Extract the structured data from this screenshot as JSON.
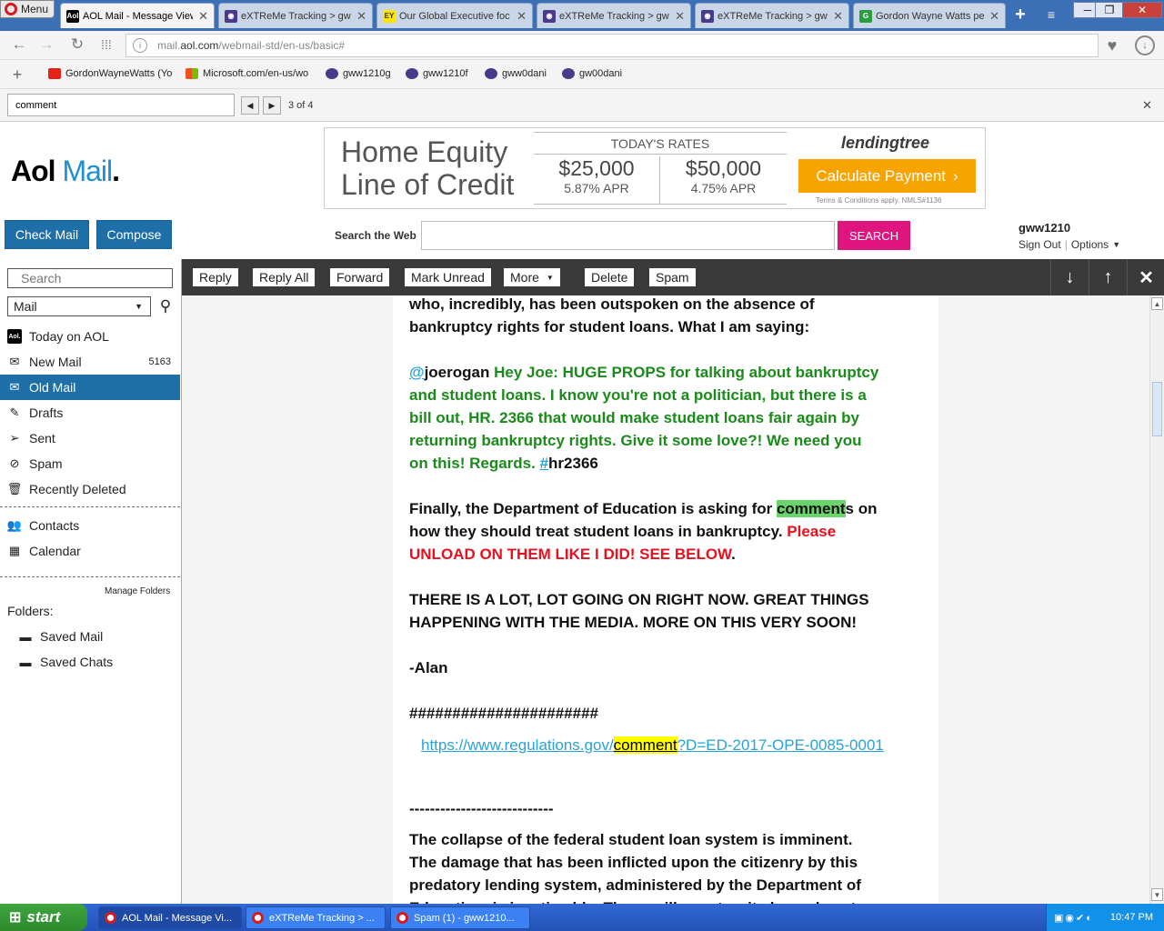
{
  "browser": {
    "menu_label": "Menu",
    "tabs": [
      {
        "icon": "aol-icon",
        "label": "AOL Mail - Message View",
        "active": true
      },
      {
        "icon": "extreme-icon",
        "label": "eXTReMe Tracking > gww"
      },
      {
        "icon": "ey-icon",
        "label": "Our Global Executive foc"
      },
      {
        "icon": "extreme-icon",
        "label": "eXTReMe Tracking > gww"
      },
      {
        "icon": "extreme-icon",
        "label": "eXTReMe Tracking > gww"
      },
      {
        "icon": "google-icon",
        "label": "Gordon Wayne Watts pe"
      }
    ],
    "url_prefix": "mail.",
    "url_domain": "aol.com",
    "url_path": "/webmail-std/en-us/basic#",
    "bookmarks": [
      {
        "icon": "youtube-icon",
        "label": "GordonWayneWatts (Yo"
      },
      {
        "icon": "microsoft-icon",
        "label": "Microsoft.com/en-us/wo"
      },
      {
        "icon": "extreme-icon",
        "label": "gww1210g"
      },
      {
        "icon": "extreme-icon",
        "label": "gww1210f"
      },
      {
        "icon": "extreme-icon",
        "label": "gww0dani"
      },
      {
        "icon": "extreme-icon",
        "label": "gw00dani"
      }
    ],
    "find": {
      "value": "comment",
      "count": "3 of 4"
    }
  },
  "aol": {
    "logo_aol": "Aol",
    "logo_mail": "Mail",
    "check_mail": "Check Mail",
    "compose": "Compose",
    "search_web_label": "Search the Web",
    "search_button": "SEARCH",
    "username": "gww1210",
    "sign_out": "Sign Out",
    "options": "Options"
  },
  "ad": {
    "headline1": "Home Equity",
    "headline2": "Line of Credit",
    "rates_title": "TODAY'S RATES",
    "rate1_amount": "$25,000",
    "rate1_apr": "5.87% APR",
    "rate2_amount": "$50,000",
    "rate2_apr": "4.75% APR",
    "brand": "lendingtree",
    "cta": "Calculate Payment",
    "fineprint": "Terms & Conditions apply. NMLS#1136"
  },
  "sidebar": {
    "search_placeholder": "Search",
    "scope": "Mail",
    "items": [
      {
        "icon": "aol-icon",
        "label": "Today on AOL",
        "count": ""
      },
      {
        "icon": "envelope-icon",
        "label": "New Mail",
        "count": "5163"
      },
      {
        "icon": "open-envelope-icon",
        "label": "Old Mail",
        "count": "",
        "active": true
      },
      {
        "icon": "drafts-icon",
        "label": "Drafts",
        "count": ""
      },
      {
        "icon": "sent-icon",
        "label": "Sent",
        "count": ""
      },
      {
        "icon": "spam-icon",
        "label": "Spam",
        "count": ""
      },
      {
        "icon": "trash-icon",
        "label": "Recently Deleted",
        "count": ""
      }
    ],
    "contacts": "Contacts",
    "calendar": "Calendar",
    "manage_folders": "Manage Folders",
    "folders_label": "Folders:",
    "folders": [
      "Saved Mail",
      "Saved Chats"
    ]
  },
  "toolbar": {
    "reply": "Reply",
    "reply_all": "Reply All",
    "forward": "Forward",
    "mark_unread": "Mark Unread",
    "more": "More",
    "delete": "Delete",
    "spam": "Spam"
  },
  "message": {
    "l1": "who, incredibly, has been outspoken on the absence of",
    "l2": "bankruptcy rights for student loans.  What I am saying:",
    "p2_at": "@",
    "p2_handle": "joerogan",
    "p2_l1": " Hey Joe: HUGE PROPS for talking about bankruptcy",
    "p2_l2": "and student loans. I know you're not a politician, but there is a",
    "p2_l3": "bill out, HR. 2366 that would make student loans fair again by",
    "p2_l4": "returning bankruptcy rights. Give it some love?! We need you",
    "p2_l5": "on this! Regards. ",
    "p2_hash": "#",
    "p2_tag": "hr2366",
    "p3_l1_a": "Finally, the Department of Education is asking for ",
    "p3_l1_hl": "comment",
    "p3_l1_b": "s on",
    "p3_l2_a": "how they should treat student loans in bankruptcy.  ",
    "p3_l2_red": "Please",
    "p3_l3_red": "UNLOAD ON THEM LIKE I DID!  SEE BELOW",
    "p3_l3_dot": ".",
    "p4_l1": "THERE IS A LOT, LOT GOING ON RIGHT NOW.  GREAT THINGS",
    "p4_l2": "HAPPENING WITH THE MEDIA.  MORE ON THIS VERY SOON!",
    "sig": "-Alan",
    "hashes": "######################",
    "link_a": "https://www.regulations.gov/",
    "link_hl": "comment",
    "link_b": "?D=ED-2017-OPE-0085-0001",
    "dashes": "----------------------------",
    "p5_l1": "The collapse of the federal student loan system is imminent.",
    "p5_l2": "The damage that has been inflicted upon the citizenry by this",
    "p5_l3": "predatory lending system, administered by the Department of",
    "p5_l4": "Education, is inestimable. These will...nocturnity hazard past"
  },
  "taskbar": {
    "start": "start",
    "tasks": [
      "AOL Mail - Message Vi...",
      "eXTReMe Tracking > ...",
      "Spam (1) - gww1210..."
    ],
    "clock": "10:47 PM"
  }
}
